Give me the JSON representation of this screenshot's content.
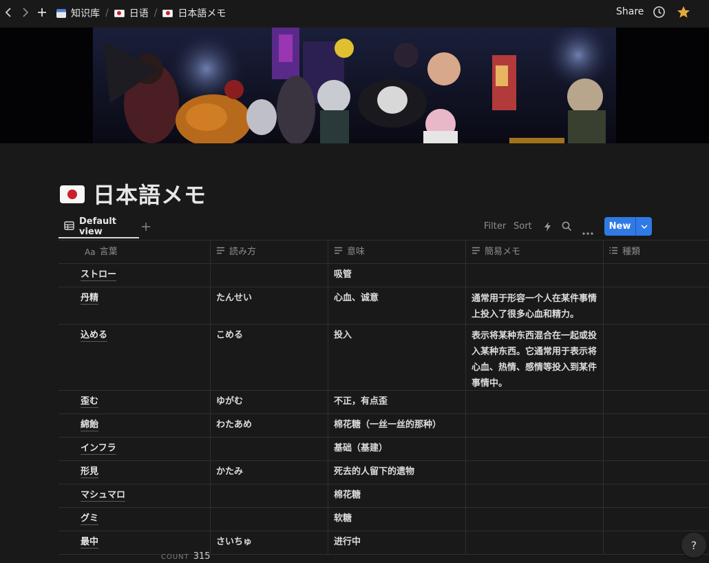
{
  "breadcrumb": [
    {
      "label": "知识库",
      "icon": "database-icon"
    },
    {
      "label": "日语",
      "icon": "japan-flag-icon"
    },
    {
      "label": "日本語メモ",
      "icon": "japan-flag-icon"
    }
  ],
  "topbar": {
    "share_label": "Share"
  },
  "page": {
    "title": "日本語メモ",
    "icon": "japan-flag-icon"
  },
  "viewbar": {
    "tab_label": "Default view",
    "filter_label": "Filter",
    "sort_label": "Sort",
    "new_label": "New"
  },
  "table": {
    "columns": [
      {
        "label": "言葉",
        "icon": "Aa"
      },
      {
        "label": "読み方",
        "icon": "text-lines-icon"
      },
      {
        "label": "意味",
        "icon": "text-lines-icon"
      },
      {
        "label": "簡易メモ",
        "icon": "text-lines-icon"
      },
      {
        "label": "種類",
        "icon": "list-icon"
      }
    ],
    "rows": [
      {
        "word": "ストロー",
        "reading": "",
        "meaning": "吸管",
        "memo": "",
        "type": ""
      },
      {
        "word": "丹精",
        "reading": "たんせい",
        "meaning": "心血、诚意",
        "memo": "通常用于形容一个人在某件事情上投入了很多心血和精力。",
        "type": ""
      },
      {
        "word": "込める",
        "reading": "こめる",
        "meaning": "投入",
        "memo": "表示将某种东西混合在一起或投入某种东西。它通常用于表示将心血、热情、感情等投入到某件事情中。",
        "type": ""
      },
      {
        "word": "歪む",
        "reading": "ゆがむ",
        "meaning": "不正，有点歪",
        "memo": "",
        "type": ""
      },
      {
        "word": "綿飴",
        "reading": "わたあめ",
        "meaning": "棉花糖（一丝一丝的那种）",
        "memo": "",
        "type": ""
      },
      {
        "word": "インフラ",
        "reading": "",
        "meaning": "基础（基建）",
        "memo": "",
        "type": ""
      },
      {
        "word": "形見",
        "reading": "かたみ",
        "meaning": "死去的人留下的遗物",
        "memo": "",
        "type": ""
      },
      {
        "word": "マシュマロ",
        "reading": "",
        "meaning": "棉花糖",
        "memo": "",
        "type": ""
      },
      {
        "word": "グミ",
        "reading": "",
        "meaning": "软糖",
        "memo": "",
        "type": ""
      },
      {
        "word": "最中",
        "reading": "さいちゅ",
        "meaning": "进行中",
        "memo": "",
        "type": ""
      }
    ]
  },
  "footer": {
    "count_label": "COUNT",
    "count_value": "315"
  },
  "help": {
    "label": "?"
  }
}
